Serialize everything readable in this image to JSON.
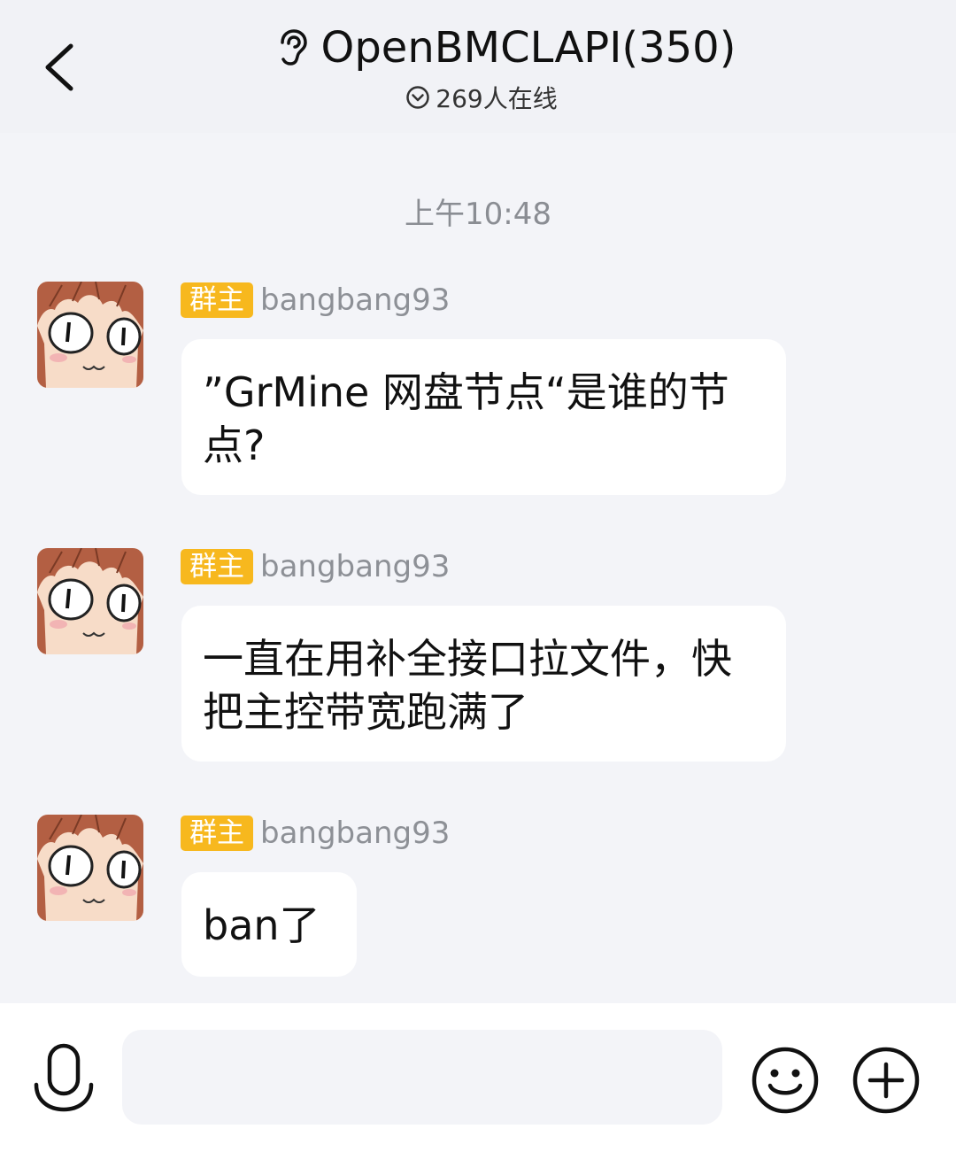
{
  "header": {
    "title": "OpenBMCLAPI(350)",
    "online_text": "269人在线",
    "icons": {
      "back": "chevron-left-icon",
      "ear": "ear-icon",
      "online": "chevron-down-circle-icon"
    }
  },
  "chat": {
    "timestamp": "上午10:48",
    "messages": [
      {
        "role": "群主",
        "sender": "bangbang93",
        "text": "”GrMine 网盘节点“是谁的节点?"
      },
      {
        "role": "群主",
        "sender": "bangbang93",
        "text": "一直在用补全接口拉文件，快把主控带宽跑满了"
      },
      {
        "role": "群主",
        "sender": "bangbang93",
        "text": "ban了"
      }
    ]
  },
  "input_bar": {
    "placeholder": "",
    "icons": {
      "voice": "microphone-icon",
      "emoji": "smiley-icon",
      "more": "plus-circle-icon"
    }
  },
  "colors": {
    "background": "#f3f4f8",
    "badge": "#f7b81e",
    "bubble": "#ffffff",
    "muted_text": "#8d9096"
  }
}
